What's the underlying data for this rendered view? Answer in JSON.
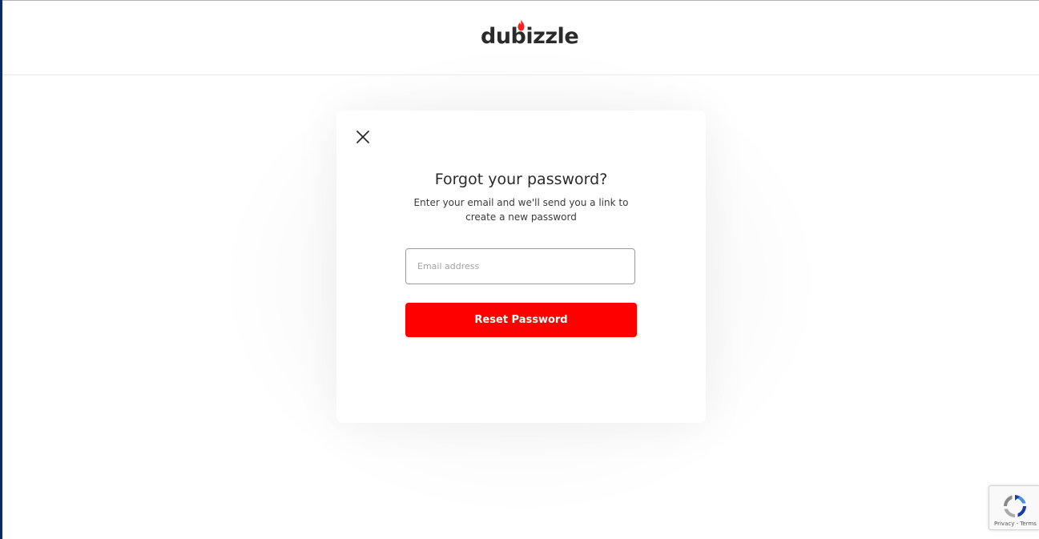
{
  "header": {
    "logo_text": "dubizzle"
  },
  "modal": {
    "title": "Forgot your password?",
    "subtitle": "Enter your email and we'll send you a link to create a new password",
    "email": {
      "value": "",
      "placeholder": "Email address"
    },
    "reset_button_label": "Reset Password"
  },
  "recaptcha": {
    "privacy_label": "Privacy",
    "separator": " - ",
    "terms_label": "Terms"
  },
  "colors": {
    "brand_red": "#ff0000",
    "logo_text": "#2b2b2b",
    "left_edge": "#0b2a6b"
  },
  "icons": {
    "logo_flame": "flame-icon",
    "close": "close-icon",
    "recaptcha": "recaptcha-icon"
  }
}
